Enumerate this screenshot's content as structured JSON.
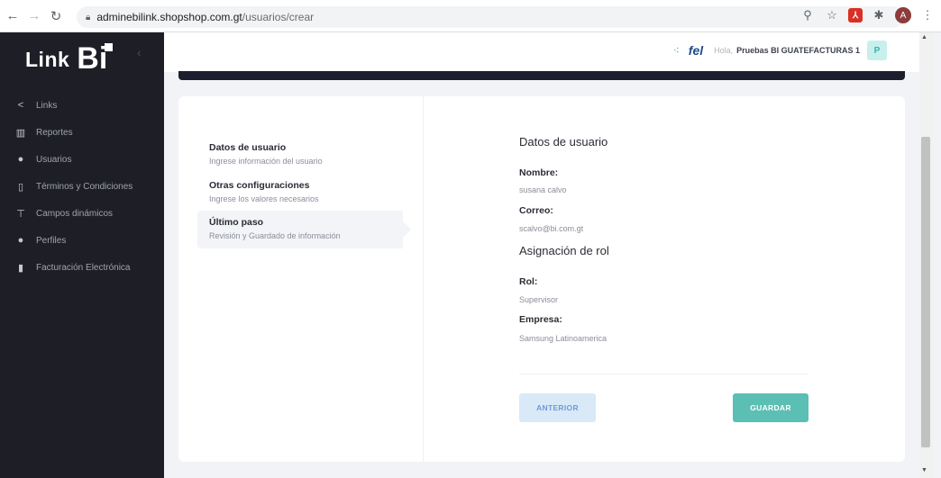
{
  "browser": {
    "url_host": "adminebilink.shopshop.com.gt",
    "url_path": "/usuarios/crear",
    "avatar_letter": "A"
  },
  "sidebar": {
    "logo_link": "Link",
    "logo_bi": "Bi",
    "items": [
      {
        "label": "Links",
        "icon": "share-icon"
      },
      {
        "label": "Reportes",
        "icon": "bar-chart-icon"
      },
      {
        "label": "Usuarios",
        "icon": "users-icon"
      },
      {
        "label": "Términos y Condiciones",
        "icon": "document-icon"
      },
      {
        "label": "Campos dinámicos",
        "icon": "text-height-icon"
      },
      {
        "label": "Perfiles",
        "icon": "user-group-icon"
      },
      {
        "label": "Facturación Electrónica",
        "icon": "file-invoice-icon"
      }
    ]
  },
  "header": {
    "fel_logo": "fel",
    "greeting": "Hola,",
    "user_name": "Pruebas BI GUATEFACTURAS 1",
    "avatar_letter": "P"
  },
  "steps": [
    {
      "title": "Datos de usuario",
      "desc": "Ingrese información del usuario"
    },
    {
      "title": "Otras configuraciones",
      "desc": "Ingrese los valores necesarios"
    },
    {
      "title": "Último paso",
      "desc": "Revisión y Guardado de información"
    }
  ],
  "review": {
    "user_section_title": "Datos de usuario",
    "nombre_label": "Nombre:",
    "nombre_value": "susana calvo",
    "correo_label": "Correo:",
    "correo_value": "scalvo@bi.com.gt",
    "role_section_title": "Asignación de rol",
    "rol_label": "Rol:",
    "rol_value": "Supervisor",
    "empresa_label": "Empresa:",
    "empresa_value": "Samsung Latinoamerica"
  },
  "buttons": {
    "previous": "ANTERIOR",
    "save": "GUARDAR"
  }
}
